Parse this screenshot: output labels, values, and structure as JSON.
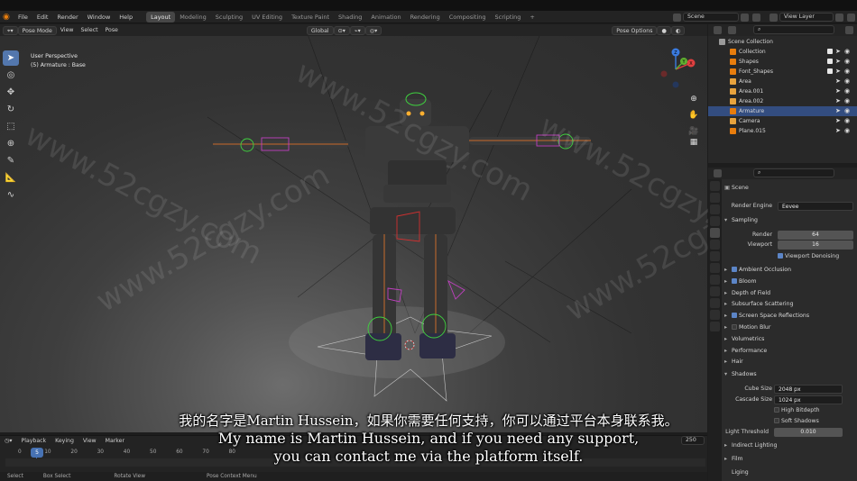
{
  "menu": [
    "File",
    "Edit",
    "Render",
    "Window",
    "Help"
  ],
  "workspaces": [
    "Layout",
    "Modeling",
    "Sculpting",
    "UV Editing",
    "Texture Paint",
    "Shading",
    "Animation",
    "Rendering",
    "Compositing",
    "Scripting"
  ],
  "add_tab": "+",
  "scene_name": "Scene",
  "view_layer": "View Layer",
  "viewport_header": {
    "mode": "Pose Mode",
    "menus": [
      "View",
      "Select",
      "Pose"
    ],
    "orientation": "Global",
    "pose_options": "Pose Options"
  },
  "viewport_info": {
    "line1": "User Perspective",
    "line2": "(5) Armature : Base"
  },
  "gizmo": {
    "x": "X",
    "y": "Y",
    "z": "Z"
  },
  "outliner": {
    "rows": [
      {
        "label": "Scene Collection",
        "indent": 0
      },
      {
        "label": "Collection",
        "indent": 1,
        "color": "#e87d0d"
      },
      {
        "label": "Shapes",
        "indent": 1,
        "color": "#e87d0d"
      },
      {
        "label": "Font_Shapes",
        "indent": 1,
        "color": "#e87d0d"
      },
      {
        "label": "Area",
        "indent": 1,
        "color": "#e8a33d"
      },
      {
        "label": "Area.001",
        "indent": 1,
        "color": "#e8a33d"
      },
      {
        "label": "Area.002",
        "indent": 1,
        "color": "#e8a33d"
      },
      {
        "label": "Armature",
        "indent": 1,
        "color": "#e87d0d",
        "selected": true
      },
      {
        "label": "Camera",
        "indent": 1,
        "color": "#e8a33d"
      },
      {
        "label": "Plane.015",
        "indent": 1,
        "color": "#e87d0d"
      }
    ]
  },
  "properties": {
    "scene": "Scene",
    "render_engine_label": "Render Engine",
    "render_engine": "Eevee",
    "sampling": "Sampling",
    "render_label": "Render",
    "render_value": "64",
    "viewport_label": "Viewport",
    "viewport_value": "16",
    "viewport_denoising": "Viewport Denoising",
    "panels": [
      {
        "label": "Ambient Occlusion",
        "checkbox": true
      },
      {
        "label": "Bloom",
        "checkbox": true
      },
      {
        "label": "Depth of Field",
        "checkbox": null
      },
      {
        "label": "Subsurface Scattering",
        "checkbox": null
      },
      {
        "label": "Screen Space Reflections",
        "checkbox": true
      },
      {
        "label": "Motion Blur",
        "checkbox": false
      },
      {
        "label": "Volumetrics",
        "checkbox": null
      },
      {
        "label": "Performance",
        "checkbox": null
      },
      {
        "label": "Hair",
        "checkbox": null
      }
    ],
    "shadows": "Shadows",
    "cube_size_label": "Cube Size",
    "cube_size": "2048 px",
    "cascade_size_label": "Cascade Size",
    "cascade_size": "1024 px",
    "high_bitdepth": "High Bitdepth",
    "soft_shadows": "Soft Shadows",
    "light_threshold_label": "Light Threshold",
    "light_threshold": "0.010",
    "indirect_lighting": "Indirect Lighting",
    "film": "Film",
    "lighting": "Liging"
  },
  "timeline": {
    "menus": [
      "Playback",
      "Keying",
      "View",
      "Marker"
    ],
    "current_frame": "5",
    "end_frame": "250",
    "ticks": [
      "0",
      "10",
      "20",
      "30",
      "40",
      "50",
      "60",
      "70",
      "80"
    ]
  },
  "statusbar": [
    "Select",
    "Box Select",
    "Rotate View",
    "Pose Context Menu"
  ],
  "subtitle": {
    "zh": "我的名字是Martin Hussein，如果你需要任何支持，你可以通过平台本身联系我。",
    "en1": "My name is Martin Hussein, and if you need any support,",
    "en2": "you can contact me via the platform itself."
  },
  "watermark": "www.52cgzy.com"
}
